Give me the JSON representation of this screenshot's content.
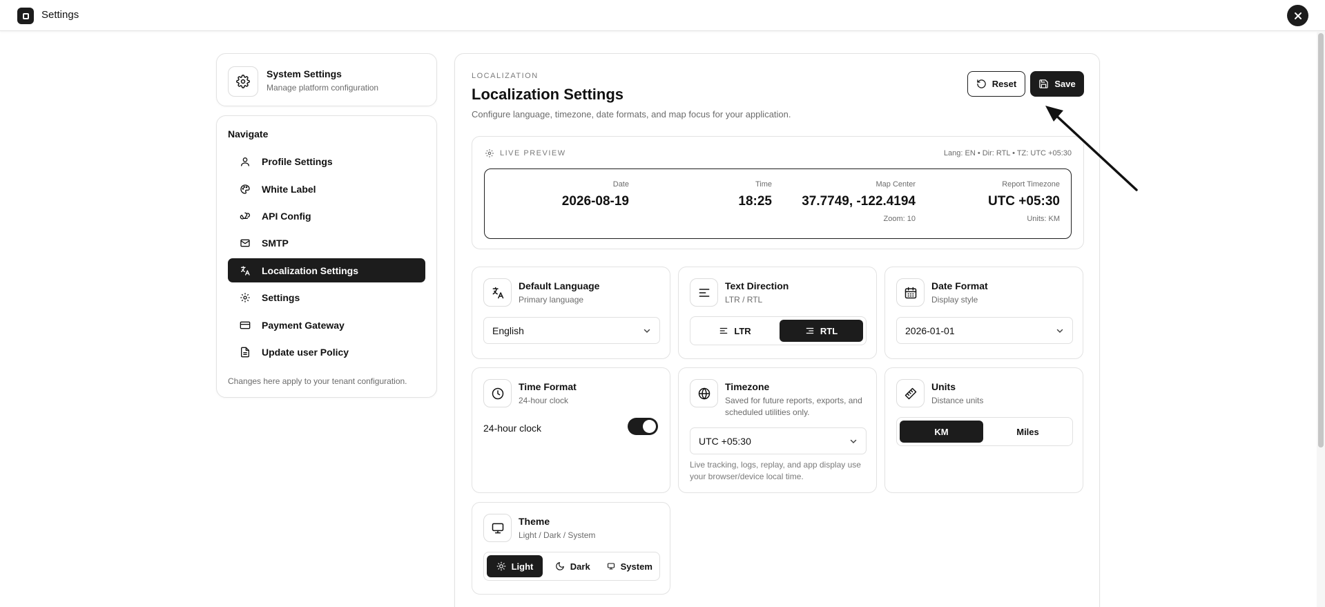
{
  "window": {
    "title": "Settings"
  },
  "sidebar": {
    "system": {
      "title": "System Settings",
      "subtitle": "Manage platform configuration",
      "icon": "gear-icon"
    },
    "nav_heading": "Navigate",
    "items": [
      {
        "label": "Profile Settings",
        "icon": "user-icon",
        "active": false
      },
      {
        "label": "White Label",
        "icon": "palette-icon",
        "active": false
      },
      {
        "label": "API Config",
        "icon": "webhook-icon",
        "active": false
      },
      {
        "label": "SMTP",
        "icon": "mail-icon",
        "active": false
      },
      {
        "label": "Localization Settings",
        "icon": "languages-icon",
        "active": true
      },
      {
        "label": "Settings",
        "icon": "gear-icon",
        "active": false
      },
      {
        "label": "Payment Gateway",
        "icon": "credit-card-icon",
        "active": false
      },
      {
        "label": "Update user Policy",
        "icon": "file-text-icon",
        "active": false
      }
    ],
    "footer": "Changes here apply to your tenant configuration."
  },
  "main": {
    "eyebrow": "LOCALIZATION",
    "title": "Localization Settings",
    "description": "Configure language, timezone, date formats, and map focus for your application.",
    "reset_label": "Reset",
    "save_label": "Save"
  },
  "preview": {
    "label": "LIVE PREVIEW",
    "meta": "Lang: EN • Dir: RTL • TZ: UTC +05:30",
    "date": {
      "key": "Date",
      "value": "2026-08-19"
    },
    "time": {
      "key": "Time",
      "value": "18:25"
    },
    "map": {
      "key": "Map Center",
      "value": "37.7749, -122.4194",
      "sub": "Zoom: 10"
    },
    "timezone": {
      "key": "Report Timezone",
      "value": "UTC +05:30",
      "sub": "Units: KM"
    }
  },
  "settings": {
    "language": {
      "title": "Default Language",
      "subtitle": "Primary language",
      "value": "English"
    },
    "direction": {
      "title": "Text Direction",
      "subtitle": "LTR / RTL",
      "options": [
        "LTR",
        "RTL"
      ],
      "selected": "RTL"
    },
    "date_format": {
      "title": "Date Format",
      "subtitle": "Display style",
      "value": "2026-01-01"
    },
    "time_format": {
      "title": "Time Format",
      "subtitle": "24-hour clock",
      "toggle_label": "24-hour clock",
      "enabled": true
    },
    "timezone": {
      "title": "Timezone",
      "subtitle": "Saved for future reports, exports, and scheduled utilities only.",
      "value": "UTC +05:30",
      "note": "Live tracking, logs, replay, and app display use your browser/device local time."
    },
    "units": {
      "title": "Units",
      "subtitle": "Distance units",
      "options": [
        "KM",
        "Miles"
      ],
      "selected": "KM"
    },
    "theme": {
      "title": "Theme",
      "subtitle": "Light / Dark / System",
      "options": [
        "Light",
        "Dark",
        "System"
      ],
      "selected": "Light"
    }
  },
  "colors": {
    "accent": "#1c1c1c",
    "border": "#e2e2e2",
    "muted": "#6b6b6b"
  }
}
